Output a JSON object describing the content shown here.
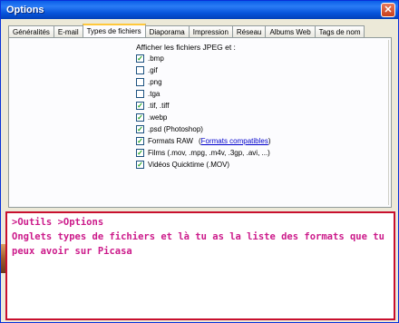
{
  "window": {
    "title": "Options"
  },
  "tabs": [
    {
      "label": "Généralités"
    },
    {
      "label": "E-mail"
    },
    {
      "label": "Types de fichiers",
      "active": true
    },
    {
      "label": "Diaporama"
    },
    {
      "label": "Impression"
    },
    {
      "label": "Réseau"
    },
    {
      "label": "Albums Web"
    },
    {
      "label": "Tags de nom"
    }
  ],
  "panel": {
    "heading": "Afficher les fichiers JPEG et :",
    "checkboxes": [
      {
        "label": ".bmp",
        "checked": true
      },
      {
        "label": ".gif",
        "checked": false
      },
      {
        "label": ".png",
        "checked": false
      },
      {
        "label": ".tga",
        "checked": false
      },
      {
        "label": ".tif, .tiff",
        "checked": true
      },
      {
        "label": ".webp",
        "checked": true
      },
      {
        "label": ".psd (Photoshop)",
        "checked": true
      },
      {
        "label": "Formats RAW",
        "checked": true,
        "paren_open": "(",
        "link": "Formats compatibles",
        "paren_close": ")"
      },
      {
        "label": "Films (.mov, .mpg, .m4v, .3gp, .avi, ...)",
        "checked": true
      },
      {
        "label": "Vidéos Quicktime (.MOV)",
        "checked": true
      }
    ]
  },
  "note": {
    "line1": ">Outils >Options",
    "line2": "Onglets types de fichiers  et là tu as la liste des formats que tu",
    "line3": "peux avoir sur Picasa"
  },
  "colors": {
    "titlebar": "#0a5ee8",
    "active_tab_accent": "#ffc83c",
    "annotation_text": "#cc1a8a",
    "annotation_border": "#c8102e",
    "checkmark": "#21a121"
  }
}
